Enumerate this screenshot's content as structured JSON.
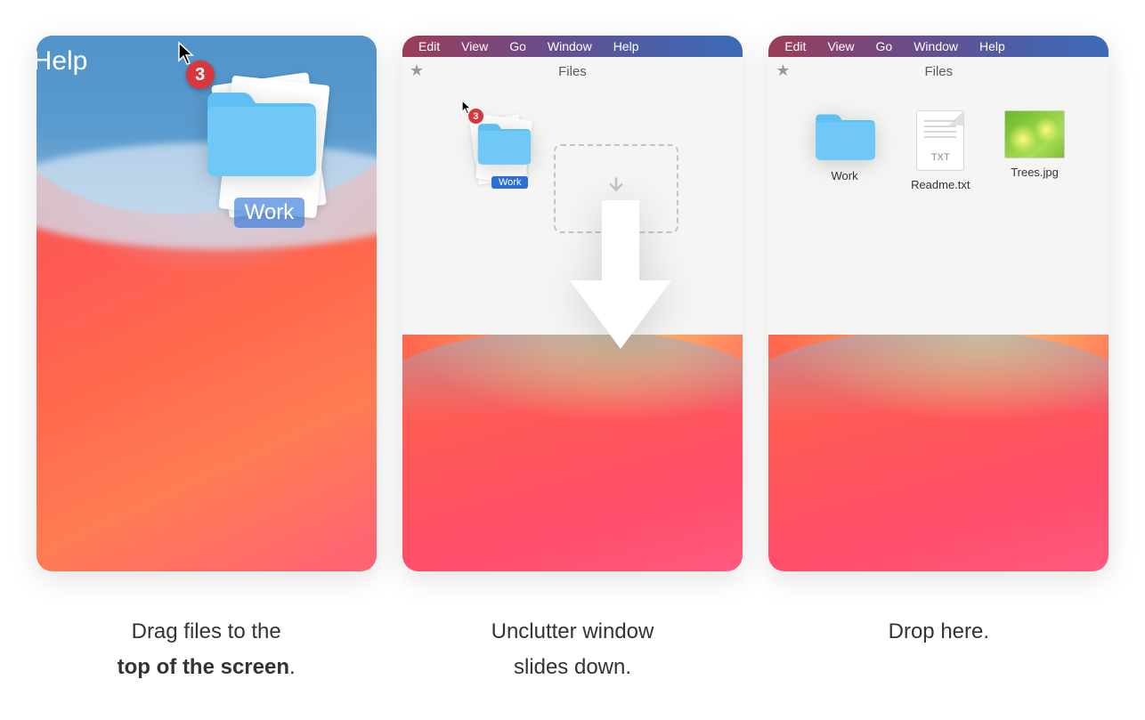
{
  "panel1": {
    "menubar_item": "Help",
    "badge": "3",
    "folder_label": "Work"
  },
  "panel2": {
    "menu": [
      "Edit",
      "View",
      "Go",
      "Window",
      "Help"
    ],
    "files_title": "Files",
    "badge": "3",
    "folder_label": "Work"
  },
  "panel3": {
    "menu": [
      "Edit",
      "View",
      "Go",
      "Window",
      "Help"
    ],
    "files_title": "Files",
    "items": [
      {
        "name": "Work",
        "type": "folder"
      },
      {
        "name": "Readme.txt",
        "type": "txt",
        "ext_label": "TXT"
      },
      {
        "name": "Trees.jpg",
        "type": "image"
      }
    ]
  },
  "captions": {
    "step1_line1": "Drag files to the",
    "step1_line2": "top of the screen",
    "step1_suffix": ".",
    "step2_line1": "Unclutter window",
    "step2_line2": "slides down.",
    "step3": "Drop here."
  }
}
